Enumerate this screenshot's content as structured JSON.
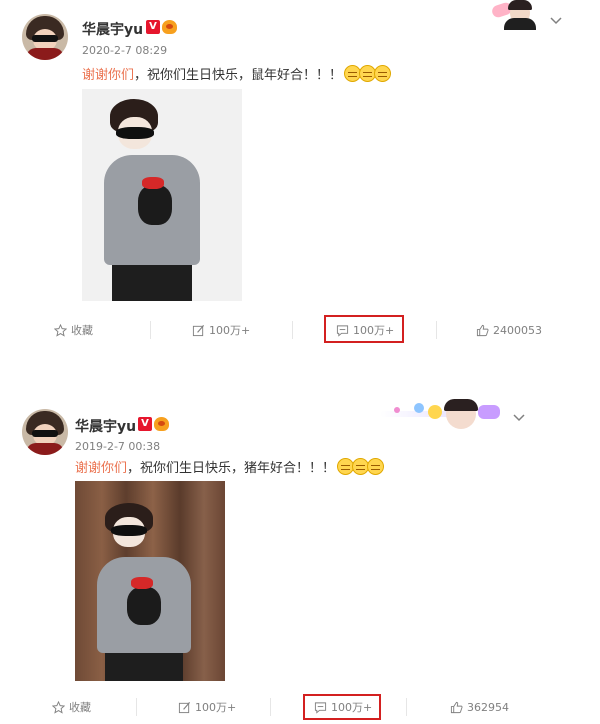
{
  "posts": [
    {
      "author": "华晨宇yu",
      "verified_badge": "V",
      "timestamp": "2020-2-7 08:29",
      "mention": "谢谢你们",
      "text": "，祝你们生日快乐，鼠年好合！！！",
      "emoji_count": 3,
      "actions": {
        "favorite": "收藏",
        "repost": "100万+",
        "comment": "100万+",
        "like": "2400053"
      }
    },
    {
      "author": "华晨宇yu",
      "verified_badge": "V",
      "timestamp": "2019-2-7 00:38",
      "mention": "谢谢你们",
      "text": "，祝你们生日快乐，猪年好合！！！",
      "emoji_count": 3,
      "actions": {
        "favorite": "收藏",
        "repost": "100万+",
        "comment": "100万+",
        "like": "362954"
      }
    }
  ],
  "icons": {
    "favorite": "star-outline-icon",
    "repost": "repost-icon",
    "comment": "comment-icon",
    "like": "thumbs-up-icon",
    "menu": "chevron-down-icon"
  },
  "colors": {
    "mention": "#eb7350",
    "highlight": "#d32020",
    "muted": "#808080"
  }
}
